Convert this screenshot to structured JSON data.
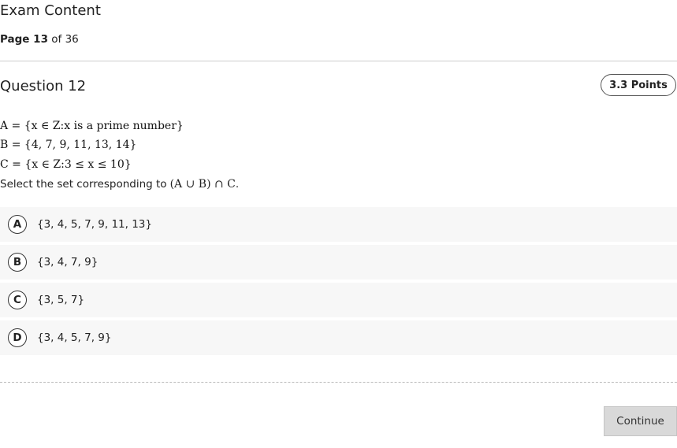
{
  "header": {
    "title": "Exam Content",
    "page_label": "Page",
    "page_number": "13",
    "page_total_text": "of 36"
  },
  "question": {
    "title": "Question 12",
    "points": "3.3 Points",
    "math_lines": [
      "A = {x ∈ Z:x is a prime number}",
      "B = {4, 7, 9, 11, 13, 14}",
      "C = {x ∈ Z:3 ≤ x ≤ 10}"
    ],
    "prompt_text": "Select the set corresponding to",
    "prompt_expression": "(A ∪ B) ∩ C",
    "prompt_end": "."
  },
  "options": [
    {
      "letter": "A",
      "text": "{3, 4, 5, 7, 9, 11, 13}"
    },
    {
      "letter": "B",
      "text": "{3, 4, 7, 9}"
    },
    {
      "letter": "C",
      "text": "{3, 5, 7}"
    },
    {
      "letter": "D",
      "text": "{3, 4, 5, 7, 9}"
    }
  ],
  "footer": {
    "continue_label": "Continue"
  },
  "colors": {
    "option_background": "#f7f7f7",
    "button_background": "#d9d9d9",
    "divider": "#cccccc"
  }
}
